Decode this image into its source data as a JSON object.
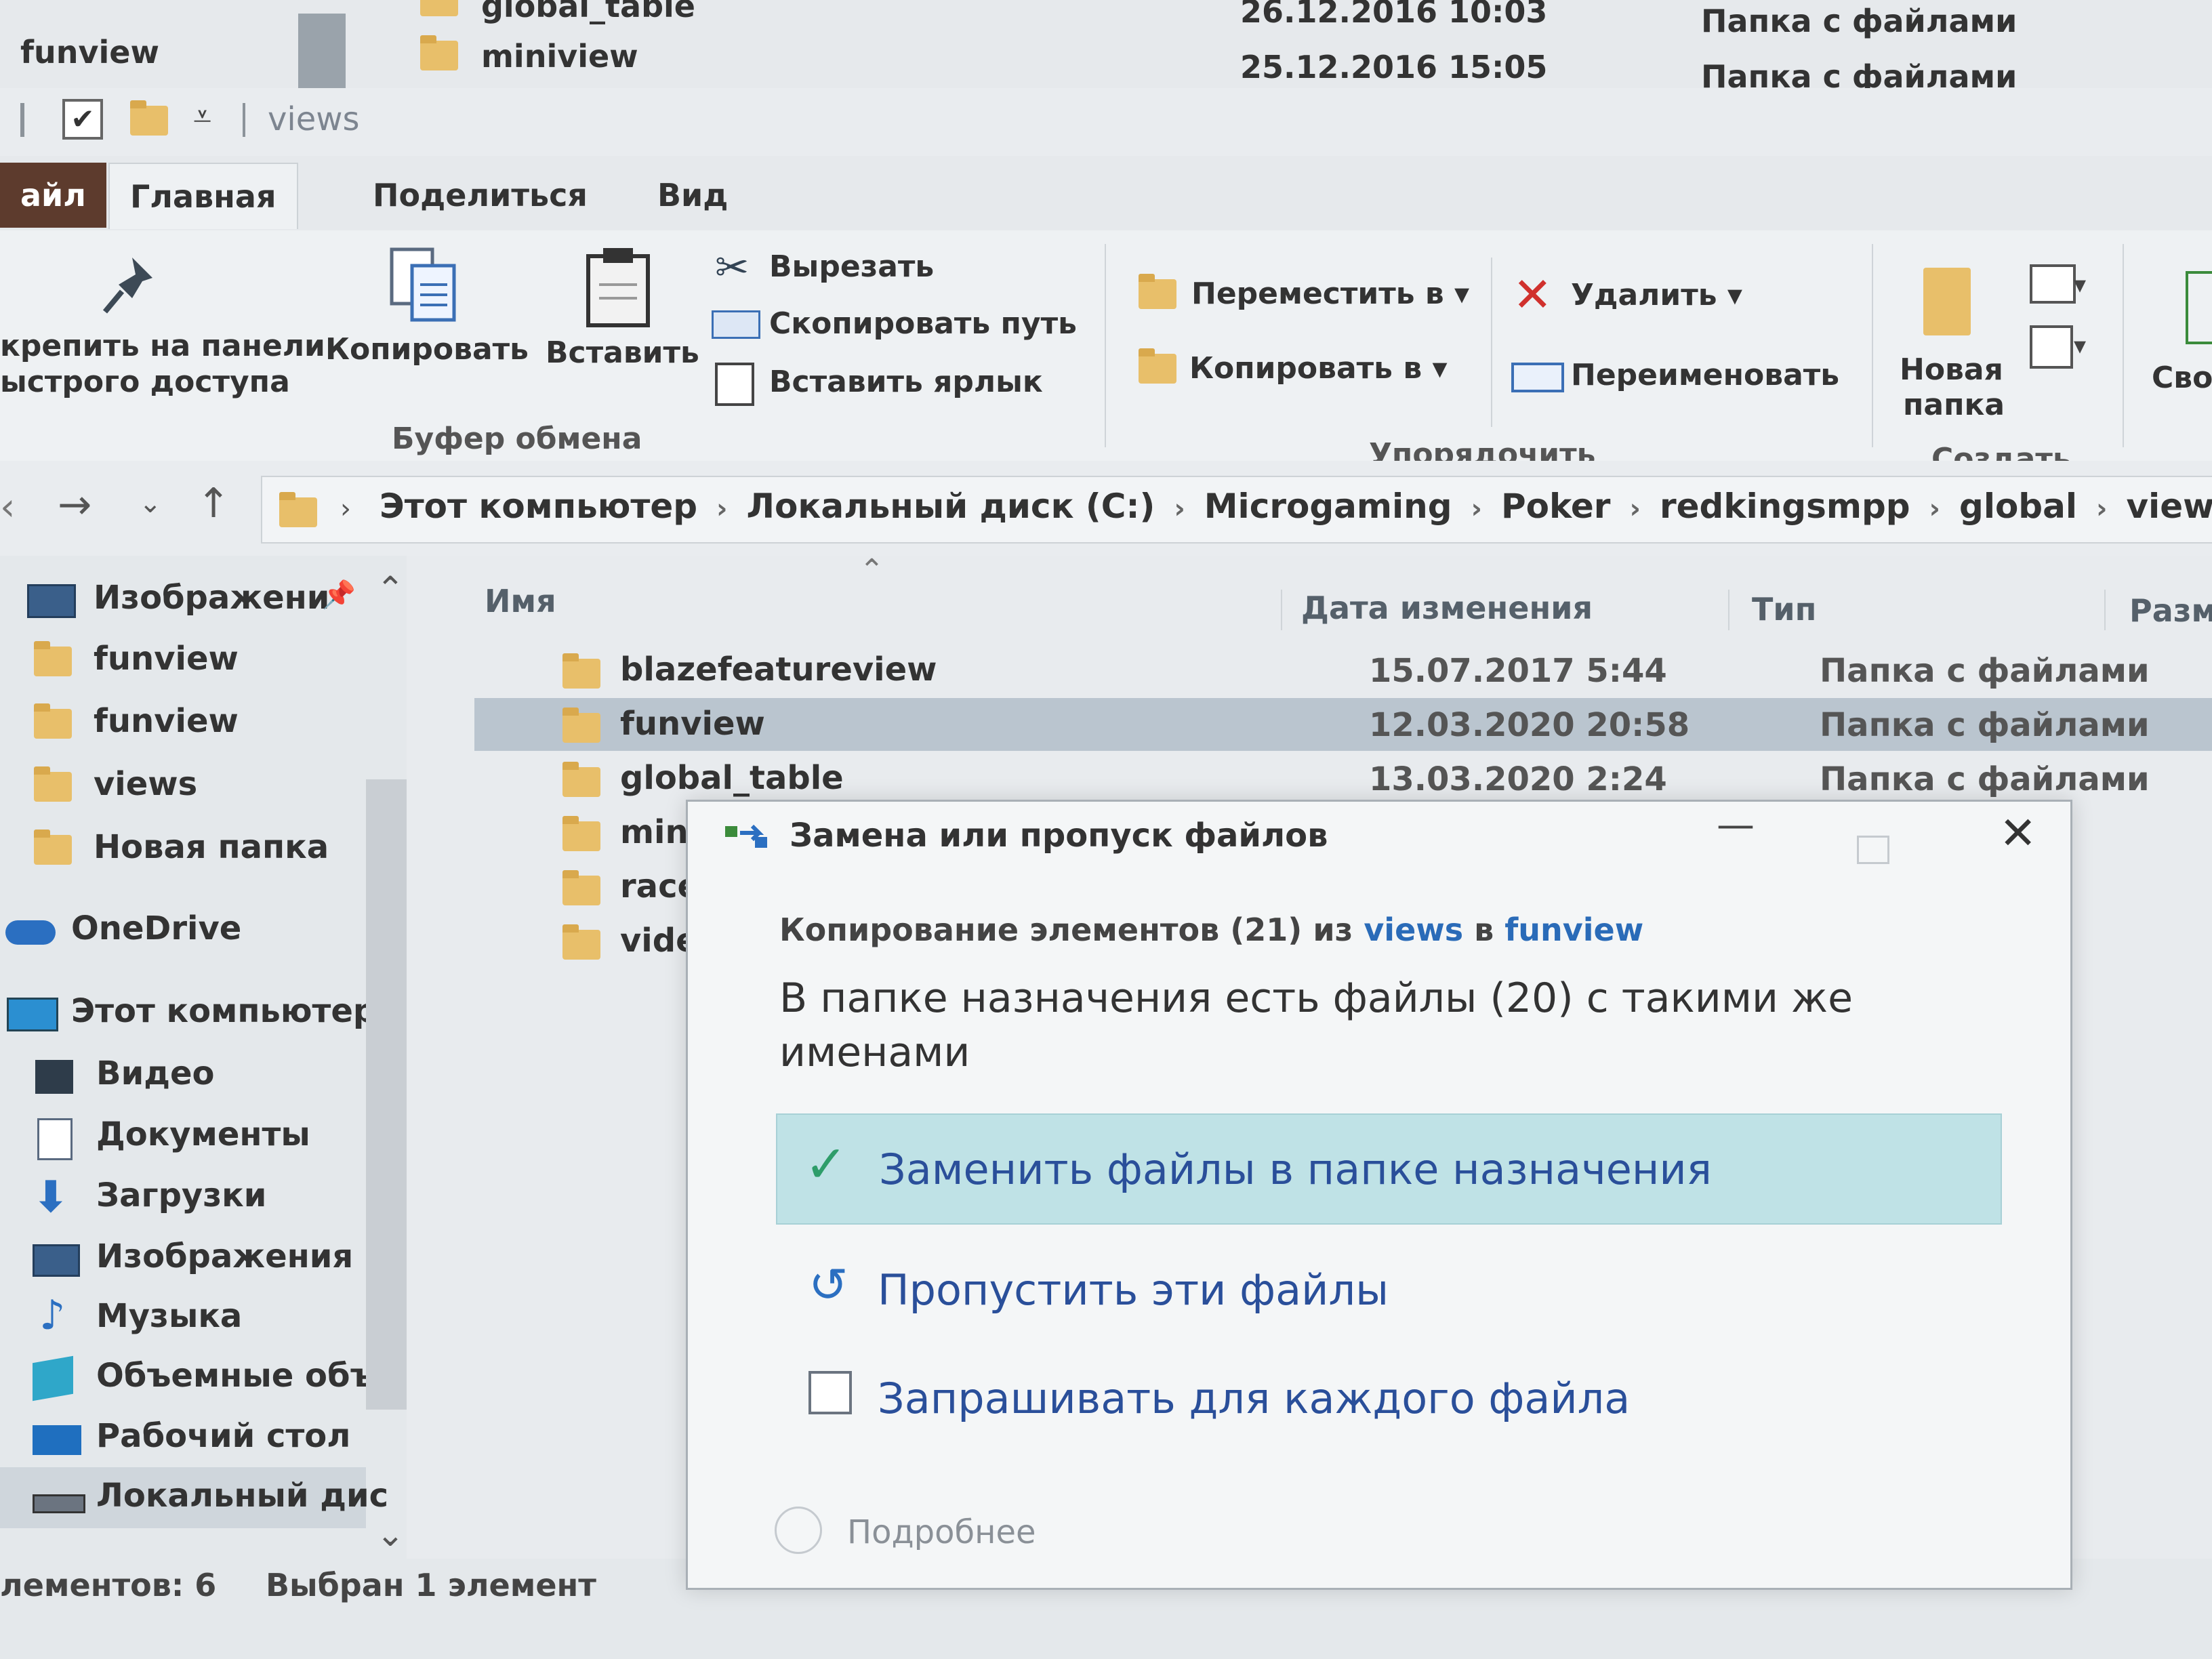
{
  "background_window": {
    "rows": [
      {
        "name": "global_table",
        "date": "26.12.2016 10:03",
        "type": "Папка с файлами"
      },
      {
        "name": "miniview",
        "date": "25.12.2016 15:05",
        "type": "Папка с файлами"
      }
    ],
    "left_item": "funview"
  },
  "quick_access": {
    "title": "views"
  },
  "tabs": {
    "file": "айл",
    "home": "Главная",
    "share": "Поделиться",
    "view": "Вид"
  },
  "ribbon": {
    "pin_label_1": "крепить на панели",
    "pin_label_2": "ыстрого доступа",
    "copy": "Копировать",
    "paste": "Вставить",
    "cut": "Вырезать",
    "copy_path": "Скопировать путь",
    "paste_shortcut": "Вставить ярлык",
    "clipboard_group": "Буфер обмена",
    "move_to": "Переместить в",
    "copy_to": "Копировать в",
    "delete": "Удалить",
    "rename": "Переименовать",
    "organize_group": "Упорядочить",
    "new_folder_1": "Новая",
    "new_folder_2": "папка",
    "create_group": "Создать",
    "props_partial": "Сво"
  },
  "address": {
    "crumbs": [
      "Этот компьютер",
      "Локальный диск (C:)",
      "Microgaming",
      "Poker",
      "redkingsmpp",
      "global",
      "views"
    ]
  },
  "nav": {
    "items": [
      {
        "label": "Изображени",
        "icon": "pictures-icon"
      },
      {
        "label": "funview",
        "icon": "folder-icon"
      },
      {
        "label": "funview",
        "icon": "folder-icon"
      },
      {
        "label": "views",
        "icon": "folder-icon"
      },
      {
        "label": "Новая папка",
        "icon": "folder-icon"
      },
      {
        "label": "OneDrive",
        "icon": "cloud-icon"
      },
      {
        "label": "Этот компьютер",
        "icon": "computer-icon"
      },
      {
        "label": "Видео",
        "icon": "video-icon"
      },
      {
        "label": "Документы",
        "icon": "documents-icon"
      },
      {
        "label": "Загрузки",
        "icon": "downloads-icon"
      },
      {
        "label": "Изображения",
        "icon": "pictures-icon"
      },
      {
        "label": "Музыка",
        "icon": "music-icon"
      },
      {
        "label": "Объемные объ",
        "icon": "3d-objects-icon"
      },
      {
        "label": "Рабочий стол",
        "icon": "desktop-icon"
      },
      {
        "label": "Локальный дис",
        "icon": "drive-icon"
      }
    ]
  },
  "files": {
    "columns": {
      "name": "Имя",
      "date": "Дата изменения",
      "type": "Тип",
      "size": "Разм"
    },
    "rows": [
      {
        "name": "blazefeatureview",
        "date": "15.07.2017 5:44",
        "type": "Папка с файлами"
      },
      {
        "name": "funview",
        "date": "12.03.2020 20:58",
        "type": "Папка с файлами"
      },
      {
        "name": "global_table",
        "date": "13.03.2020 2:24",
        "type": "Папка с файлами"
      },
      {
        "name": "miniview",
        "date": "",
        "type": ""
      },
      {
        "name": "racetrack",
        "date": "",
        "type": ""
      },
      {
        "name": "videoview",
        "date": "",
        "type": ""
      }
    ]
  },
  "status": {
    "count": "лементов: 6",
    "selected": "Выбран 1 элемент"
  },
  "dialog": {
    "title": "Замена или пропуск файлов",
    "sub_prefix": "Копирование элементов (21) из",
    "sub_from": "views",
    "sub_mid": "в",
    "sub_to": "funview",
    "message": "В папке назначения есть файлы (20) с такими же именами",
    "option_replace": "Заменить файлы в папке назначения",
    "option_skip": "Пропустить эти файлы",
    "option_ask": "Запрашивать для каждого файла",
    "details": "Подробнее"
  }
}
